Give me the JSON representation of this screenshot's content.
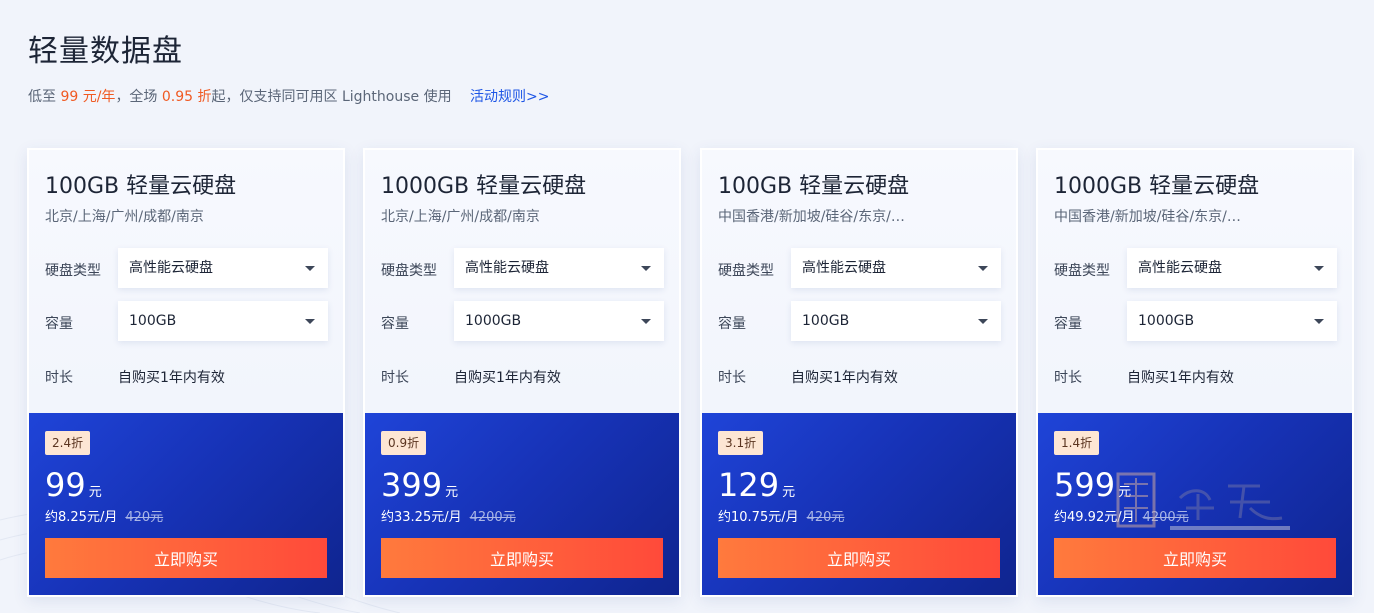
{
  "header": {
    "title": "轻量数据盘",
    "subtitle_pre": "低至",
    "subtitle_price": "99 元/年",
    "subtitle_mid": "，全场",
    "subtitle_discount": "0.95 折",
    "subtitle_post": "起，仅支持同可用区 Lighthouse 使用",
    "rules_link": "活动规则>>"
  },
  "labels": {
    "disk_type": "硬盘类型",
    "capacity": "容量",
    "duration": "时长"
  },
  "cards": [
    {
      "title": "100GB 轻量云硬盘",
      "regions": "北京/上海/广州/成都/南京",
      "disk_type": "高性能云硬盘",
      "capacity": "100GB",
      "duration": "自购买1年内有效",
      "discount": "2.4折",
      "price": "99",
      "price_unit": "元",
      "monthly": "约8.25元/月",
      "original": "420元",
      "buy_label": "立即购买"
    },
    {
      "title": "1000GB 轻量云硬盘",
      "regions": "北京/上海/广州/成都/南京",
      "disk_type": "高性能云硬盘",
      "capacity": "1000GB",
      "duration": "自购买1年内有效",
      "discount": "0.9折",
      "price": "399",
      "price_unit": "元",
      "monthly": "约33.25元/月",
      "original": "4200元",
      "buy_label": "立即购买"
    },
    {
      "title": "100GB 轻量云硬盘",
      "regions": "中国香港/新加坡/硅谷/东京/…",
      "disk_type": "高性能云硬盘",
      "capacity": "100GB",
      "duration": "自购买1年内有效",
      "discount": "3.1折",
      "price": "129",
      "price_unit": "元",
      "monthly": "约10.75元/月",
      "original": "420元",
      "buy_label": "立即购买"
    },
    {
      "title": "1000GB 轻量云硬盘",
      "regions": "中国香港/新加坡/硅谷/东京/…",
      "disk_type": "高性能云硬盘",
      "capacity": "1000GB",
      "duration": "自购买1年内有效",
      "discount": "1.4折",
      "price": "599",
      "price_unit": "元",
      "monthly": "约49.92元/月",
      "original": "4200元",
      "buy_label": "立即购买"
    }
  ],
  "icons": {
    "dropdown": "chevron-down-icon"
  },
  "colors": {
    "accent_orange": "#f05a23",
    "link_blue": "#1e56e6",
    "price_bg": "#1733b8",
    "buy_button": "#ff5a3a",
    "badge_bg": "#fde6d4"
  }
}
